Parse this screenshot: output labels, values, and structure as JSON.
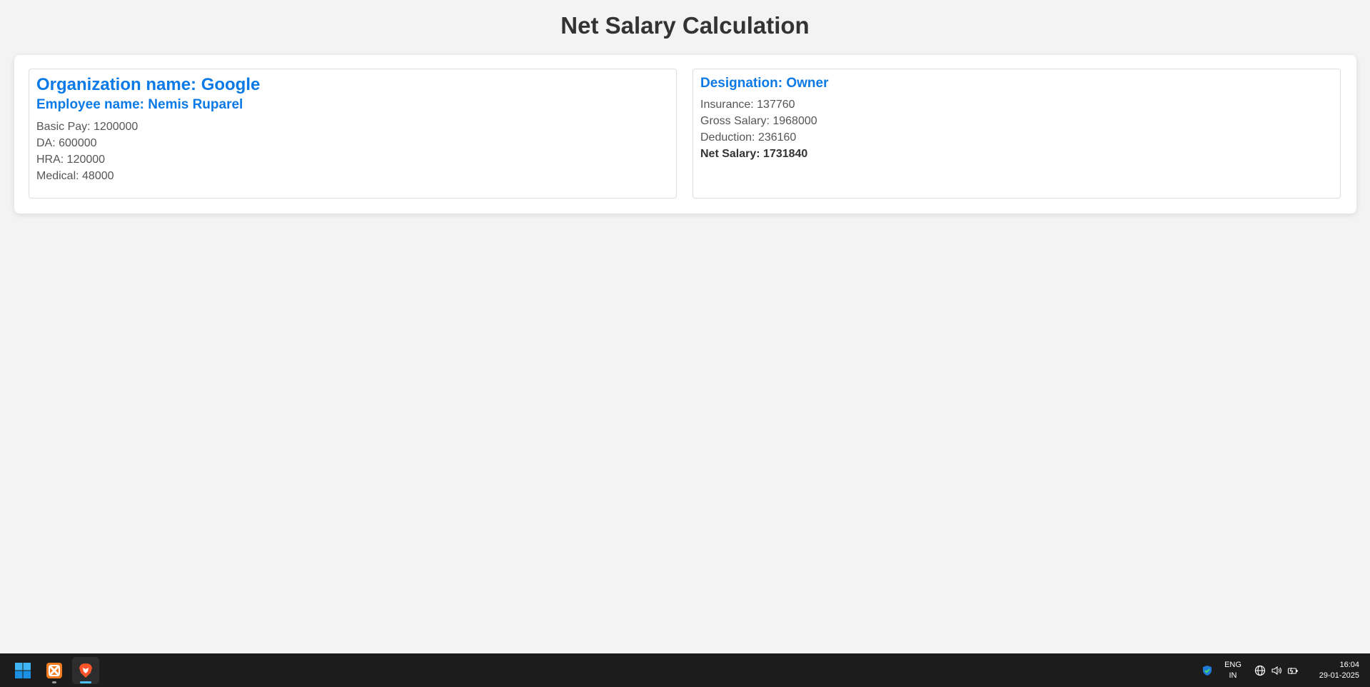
{
  "page": {
    "title": "Net Salary Calculation"
  },
  "employee_card": {
    "organization": "Organization name: Google",
    "employee": "Employee name: Nemis Ruparel",
    "basic_pay": "Basic Pay: 1200000",
    "da": "DA: 600000",
    "hra": "HRA: 120000",
    "medical": "Medical: 48000"
  },
  "salary_card": {
    "designation": "Designation: Owner",
    "insurance": "Insurance: 137760",
    "gross_salary": "Gross Salary: 1968000",
    "deduction": "Deduction: 236160",
    "net_salary": "Net Salary: 1731840"
  },
  "colors": {
    "accent": "#0b7ae6",
    "background": "#f3f3f3",
    "taskbar": "#1c1c1c"
  },
  "taskbar": {
    "apps": [
      {
        "name": "start-icon"
      },
      {
        "name": "xampp-icon"
      },
      {
        "name": "brave-browser-icon"
      }
    ],
    "language_line1": "ENG",
    "language_line2": "IN",
    "time": "16:04",
    "date": "29-01-2025"
  }
}
